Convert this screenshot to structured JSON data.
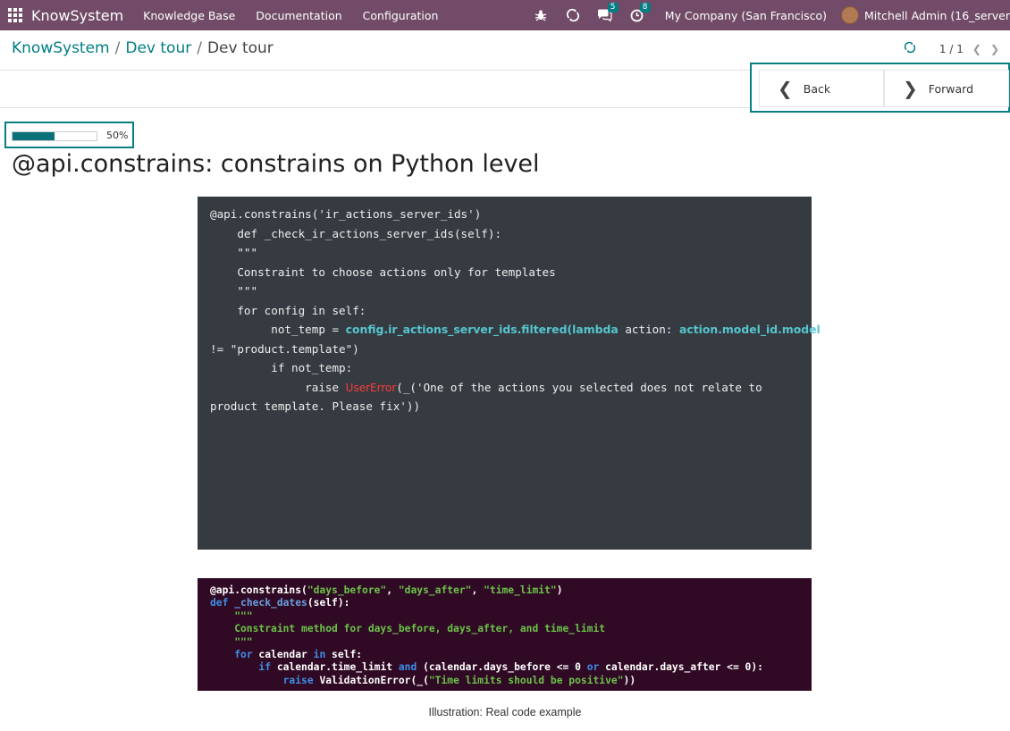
{
  "navbar": {
    "app_name": "KnowSystem",
    "menu": [
      "Knowledge Base",
      "Documentation",
      "Configuration"
    ],
    "chat_badge": "5",
    "activity_badge": "8",
    "company": "My Company (San Francisco)",
    "user": "Mitchell Admin (16_server"
  },
  "breadcrumb": {
    "root": "KnowSystem",
    "parent": "Dev tour",
    "current": "Dev tour"
  },
  "pager": {
    "value": "1 / 1"
  },
  "tour_nav": {
    "back_label": "Back",
    "forward_label": "Forward"
  },
  "progress": {
    "percent": 50,
    "label": "50%"
  },
  "article": {
    "title": "@api.constrains: constrains on Python level",
    "code_example": {
      "l1": "@api.constrains('ir_actions_server_ids')",
      "l2": "    def _check_ir_actions_server_ids(self):",
      "l3": "    \"\"\"",
      "l4": "    Constraint to choose actions only for templates",
      "l5": "    \"\"\"",
      "l6": "    for config in self:",
      "l7_a": "         not_temp = ",
      "l7_b": "config.ir_actions_server_ids.filtered(lambda",
      "l7_c": " action: ",
      "l7_d": "action.model_id.model",
      "l8": "!= \"product.template\")",
      "l9": "         if not_temp:",
      "l10_a": "              raise ",
      "l10_b": "UserError",
      "l10_c": "(_('One of the actions you selected does not relate to",
      "l11": "product template. Please fix'))"
    },
    "screenshot_code": {
      "l1_a": "@api.constrains(",
      "l1_b": "\"days_before\"",
      "l1_c": ", ",
      "l1_d": "\"days_after\"",
      "l1_e": ", ",
      "l1_f": "\"time_limit\"",
      "l1_g": ")",
      "l2_a": "def ",
      "l2_b": "_check_dates",
      "l2_c": "(self):",
      "l3": "    \"\"\"",
      "l4": "    Constraint method for days_before, days_after, and time_limit",
      "l5": "    \"\"\"",
      "l6_a": "    ",
      "l6_b": "for",
      "l6_c": " calendar ",
      "l6_d": "in",
      "l6_e": " self:",
      "l7_a": "        ",
      "l7_b": "if",
      "l7_c": " calendar.time_limit ",
      "l7_d": "and",
      "l7_e": " (calendar.days_before <= 0 ",
      "l7_f": "or",
      "l7_g": " calendar.days_after <= 0):",
      "l8_a": "            ",
      "l8_b": "raise",
      "l8_c": " ValidationError(_(",
      "l8_d": "\"Time limits should be positive\"",
      "l8_e": "))"
    },
    "caption": "Illustration: Real code example"
  }
}
